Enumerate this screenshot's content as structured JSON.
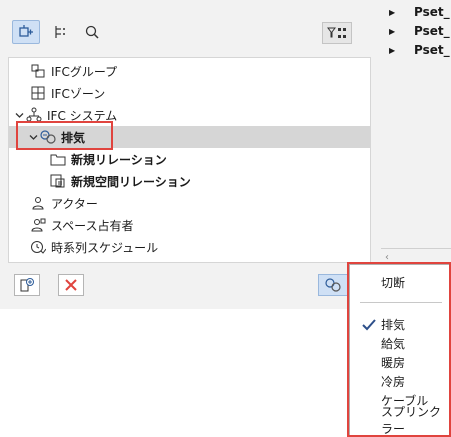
{
  "tree": {
    "items": [
      {
        "label": "IFCグループ",
        "icon": "ifc-group-icon"
      },
      {
        "label": "IFCゾーン",
        "icon": "ifc-zone-icon"
      },
      {
        "label": "IFC システム",
        "icon": "ifc-system-icon",
        "expanded": true
      },
      {
        "label": "排気",
        "icon": "exhaust-system-icon",
        "expanded": true,
        "selected": true
      },
      {
        "label": "新規リレーション",
        "icon": "folder-icon"
      },
      {
        "label": "新規空間リレーション",
        "icon": "space-relation-icon"
      },
      {
        "label": "アクター",
        "icon": "actor-icon"
      },
      {
        "label": "スペース占有者",
        "icon": "space-occupant-icon"
      },
      {
        "label": "時系列スケジュール",
        "icon": "time-schedule-icon"
      }
    ]
  },
  "right_panel": {
    "psets": [
      "Pset_",
      "Pset_",
      "Pset_"
    ]
  },
  "menu": {
    "header": "切断",
    "items": [
      "排気",
      "給気",
      "暖房",
      "冷房",
      "ケーブル",
      "スプリンクラー"
    ],
    "checked": "排気"
  },
  "colors": {
    "highlight_red": "#e0443e",
    "selected_row": "#d6d6d6",
    "active_tool": "#cfe0f5",
    "panel_bg": "#f2f2f2"
  }
}
